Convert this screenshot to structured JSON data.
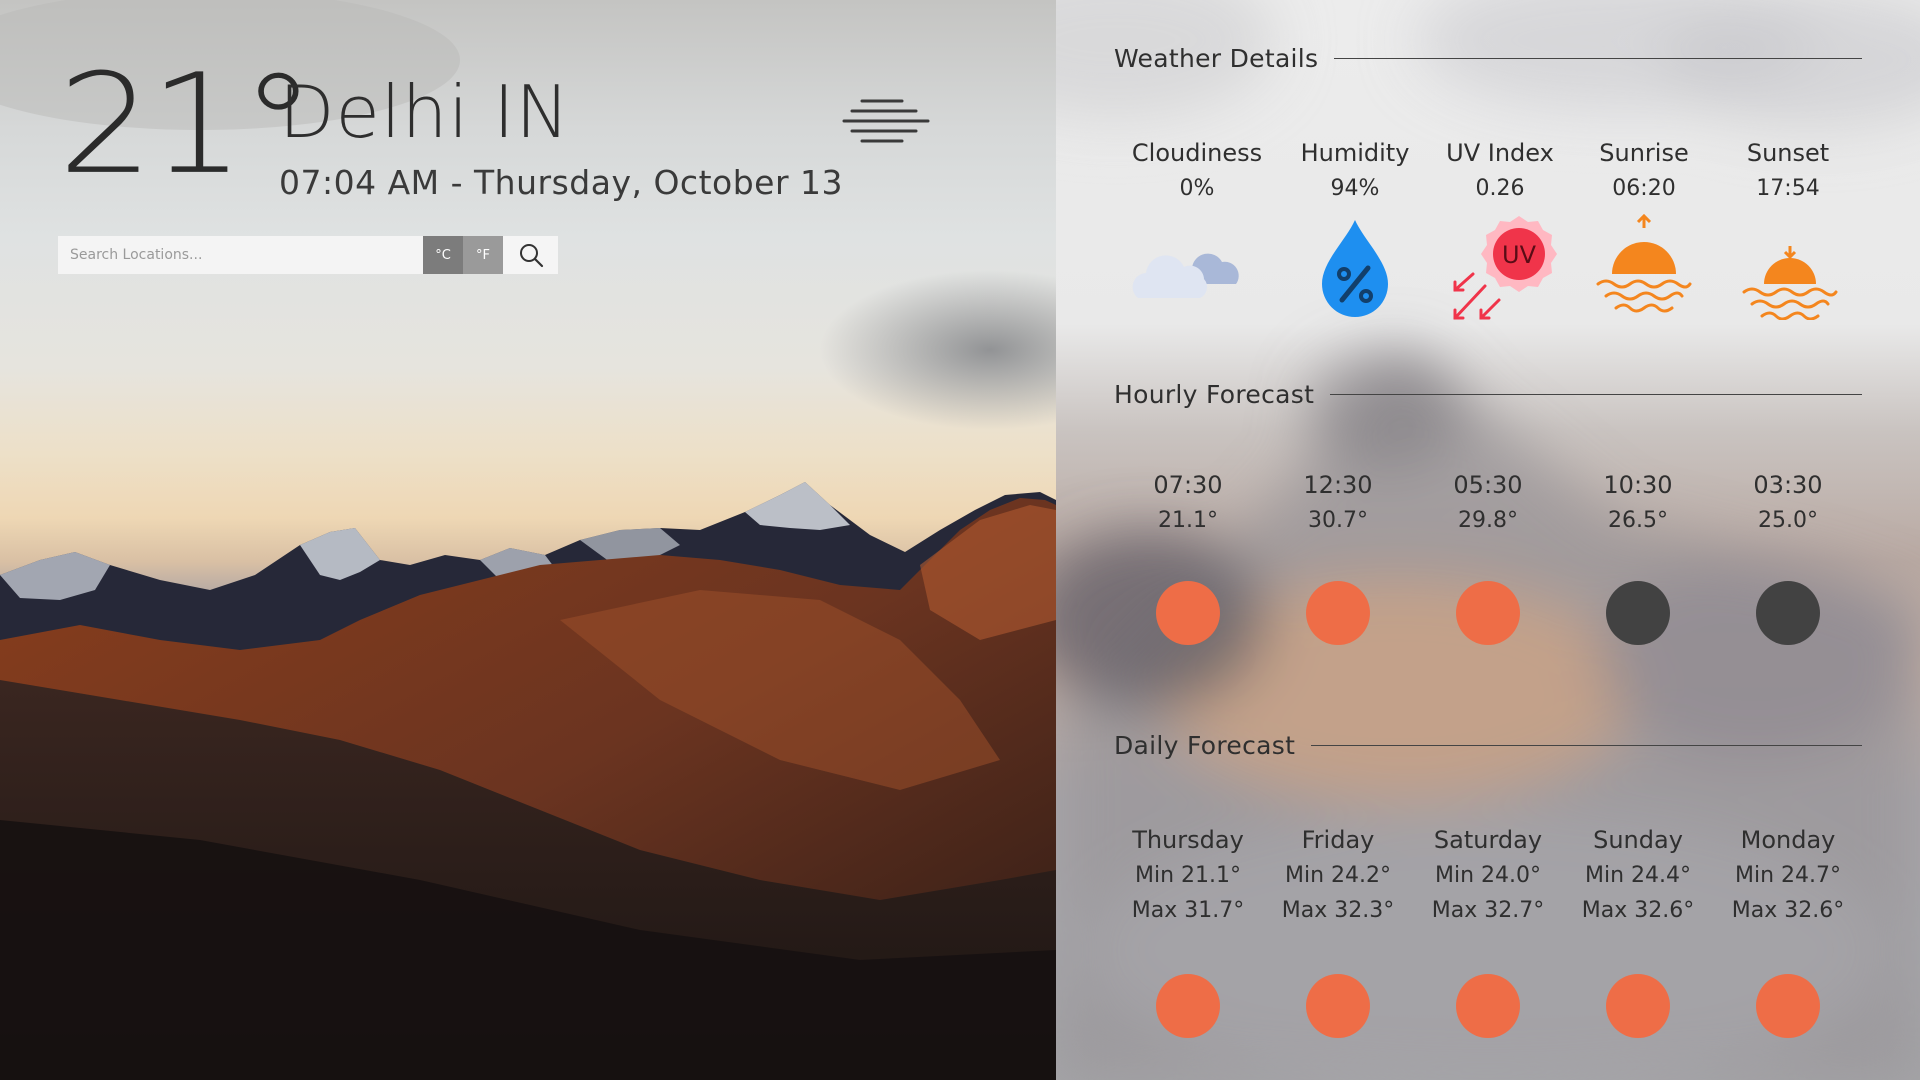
{
  "current": {
    "temperature": "21°",
    "location": "Delhi IN",
    "datetime": "07:04 AM - Thursday, October 13",
    "condition_icon": "fog-haze-icon"
  },
  "search": {
    "placeholder": "Search Locations...",
    "celsius_label": "°C",
    "fahrenheit_label": "°F",
    "search_icon": "search-icon"
  },
  "details": {
    "title": "Weather Details",
    "items": [
      {
        "label": "Cloudiness",
        "value": "0%",
        "icon": "cloud-icon"
      },
      {
        "label": "Humidity",
        "value": "94%",
        "icon": "humidity-drop-icon"
      },
      {
        "label": "UV Index",
        "value": "0.26",
        "icon": "uv-sun-icon"
      },
      {
        "label": "Sunrise",
        "value": "06:20",
        "icon": "sunrise-icon"
      },
      {
        "label": "Sunset",
        "value": "17:54",
        "icon": "sunset-icon"
      }
    ]
  },
  "hourly": {
    "title": "Hourly Forecast",
    "items": [
      {
        "time": "07:30",
        "temp": "21.1°",
        "period": "day"
      },
      {
        "time": "12:30",
        "temp": "30.7°",
        "period": "day"
      },
      {
        "time": "05:30",
        "temp": "29.8°",
        "period": "day"
      },
      {
        "time": "10:30",
        "temp": "26.5°",
        "period": "night"
      },
      {
        "time": "03:30",
        "temp": "25.0°",
        "period": "night"
      }
    ]
  },
  "daily": {
    "title": "Daily Forecast",
    "items": [
      {
        "day": "Thursday",
        "min": "Min 21.1°",
        "max": "Max 31.7°"
      },
      {
        "day": "Friday",
        "min": "Min 24.2°",
        "max": "Max 32.3°"
      },
      {
        "day": "Saturday",
        "min": "Min 24.0°",
        "max": "Max 32.7°"
      },
      {
        "day": "Sunday",
        "min": "Min 24.4°",
        "max": "Max 32.6°"
      },
      {
        "day": "Monday",
        "min": "Min 24.7°",
        "max": "Max 32.6°"
      }
    ]
  },
  "colors": {
    "day_dot": "#ee6d47",
    "night_dot": "#424242",
    "humidity_blue": "#1e8ff0",
    "uv_red": "#f0344a",
    "sun_orange": "#f4861e"
  }
}
